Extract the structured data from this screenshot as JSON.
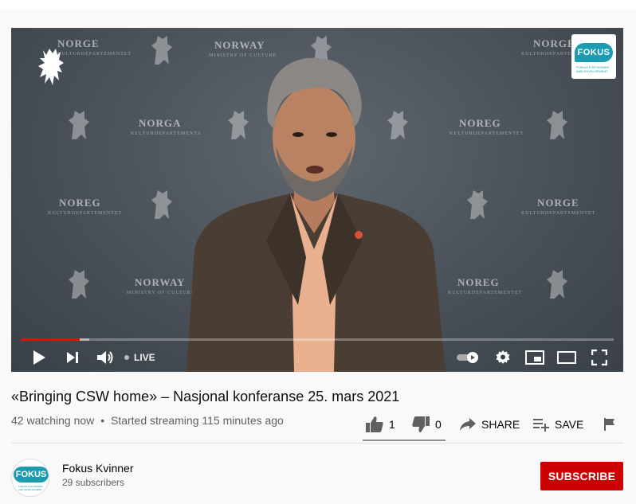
{
  "video": {
    "watermarks": [
      {
        "title": "NORGE",
        "sub": "KULTURDEPARTEMENTET"
      },
      {
        "title": "NORWAY",
        "sub": "MINISTRY OF CULTURE"
      },
      {
        "title": "NORGA",
        "sub": "KULTURDEPARTEMENTA"
      },
      {
        "title": "NOREG",
        "sub": "KULTURDEPARTEMENTET"
      },
      {
        "title": "NORGE",
        "sub": "KULTURDEPARTEMENTET"
      }
    ],
    "fokus_logo": {
      "name": "FOKUS",
      "tagline": "FORUM FOR WOMEN AND DEVELOPMENT"
    },
    "progress": {
      "played": 0.1,
      "buffered": 0.115
    },
    "controls": {
      "live_label": "LIVE",
      "icons": [
        "play-icon",
        "next-icon",
        "volume-icon",
        "autoplay-toggle-icon",
        "settings-gear-icon",
        "miniplayer-icon",
        "theater-mode-icon",
        "fullscreen-icon"
      ]
    }
  },
  "info": {
    "title": "«Bringing CSW home» – Nasjonal konferanse 25. mars 2021",
    "watching": "42 watching now",
    "separator": "•",
    "started": "Started streaming 115 minutes ago"
  },
  "actions": {
    "like_count": "1",
    "dislike_count": "0",
    "share_label": "SHARE",
    "save_label": "SAVE"
  },
  "channel": {
    "name": "Fokus Kvinner",
    "subscribers": "29 subscribers",
    "avatar_text": "FOKUS",
    "avatar_tagline": "FORUM FOR WOMEN AND DEVELOPMENT",
    "subscribe_label": "SUBSCRIBE"
  },
  "colors": {
    "accent": "#cc0000",
    "progress": "#ff0000",
    "brand_teal": "#1b9cb0"
  }
}
